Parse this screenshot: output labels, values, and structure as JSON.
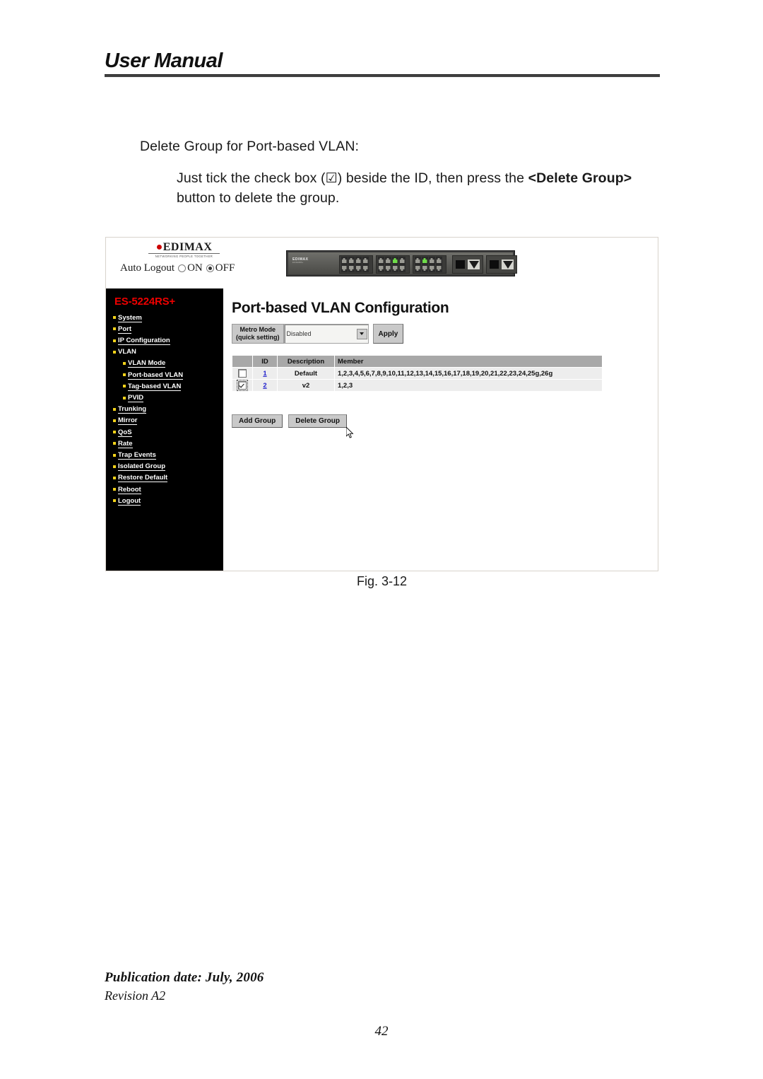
{
  "header": {
    "manual_title": "User Manual"
  },
  "content": {
    "lead": "Delete Group for Port-based VLAN:",
    "body_part1": "Just tick the check box (",
    "tick_glyph": "☑",
    "body_part2": ") beside the ID, then press the ",
    "body_bold1": "<Delete Group>",
    "body_part3": " button to delete the group."
  },
  "figure": {
    "caption": "Fig. 3-12",
    "topbar": {
      "brand": "EDIMAX",
      "brand_tagline": "NETWORKING PEOPLE TOGETHER",
      "auto_logout_label": "Auto Logout",
      "radio_on_label": "ON",
      "radio_off_label": "OFF",
      "radio_selected": "OFF",
      "device_brand": "EDIMAX",
      "device_brand_sub": "ES-5224RS+"
    },
    "nav": {
      "model": "ES-5224RS+",
      "items": [
        {
          "label": "System",
          "sub": false
        },
        {
          "label": "Port",
          "sub": false
        },
        {
          "label": "IP Configuration",
          "sub": false
        },
        {
          "label": "VLAN",
          "sub": false,
          "no_underline": true
        },
        {
          "label": "VLAN Mode",
          "sub": true
        },
        {
          "label": "Port-based VLAN",
          "sub": true
        },
        {
          "label": "Tag-based VLAN",
          "sub": true
        },
        {
          "label": "PVID",
          "sub": true
        },
        {
          "label": "Trunking",
          "sub": false
        },
        {
          "label": "Mirror",
          "sub": false
        },
        {
          "label": "QoS",
          "sub": false
        },
        {
          "label": "Rate",
          "sub": false
        },
        {
          "label": "Trap Events",
          "sub": false
        },
        {
          "label": "Isolated Group",
          "sub": false
        },
        {
          "label": "Restore Default",
          "sub": false
        },
        {
          "label": "Reboot",
          "sub": false
        },
        {
          "label": "Logout",
          "sub": false
        }
      ]
    },
    "main": {
      "title": "Port-based VLAN Configuration",
      "metro_label_line1": "Metro Mode",
      "metro_label_line2": "(quick setting)",
      "metro_value": "Disabled",
      "metro_options": [
        "Disabled"
      ],
      "apply_label": "Apply",
      "table": {
        "columns": [
          "",
          "ID",
          "Description",
          "Member"
        ],
        "rows": [
          {
            "checked": false,
            "id": "1",
            "description": "Default",
            "member": "1,2,3,4,5,6,7,8,9,10,11,12,13,14,15,16,17,18,19,20,21,22,23,24,25g,26g"
          },
          {
            "checked": true,
            "id": "2",
            "description": "v2",
            "member": "1,2,3"
          }
        ]
      },
      "add_group_label": "Add Group",
      "delete_group_label": "Delete Group"
    },
    "colors": {
      "model_red": "#ee0000",
      "nav_background": "#000000",
      "link_blue": "#2222cc",
      "table_header_gray": "#a8a8a8",
      "table_row_gray": "#ededed",
      "port_active_green": "#6fdc49"
    }
  },
  "footer": {
    "publication_date": "Publication date: July, 2006",
    "revision": "Revision A2",
    "page_number": "42"
  }
}
